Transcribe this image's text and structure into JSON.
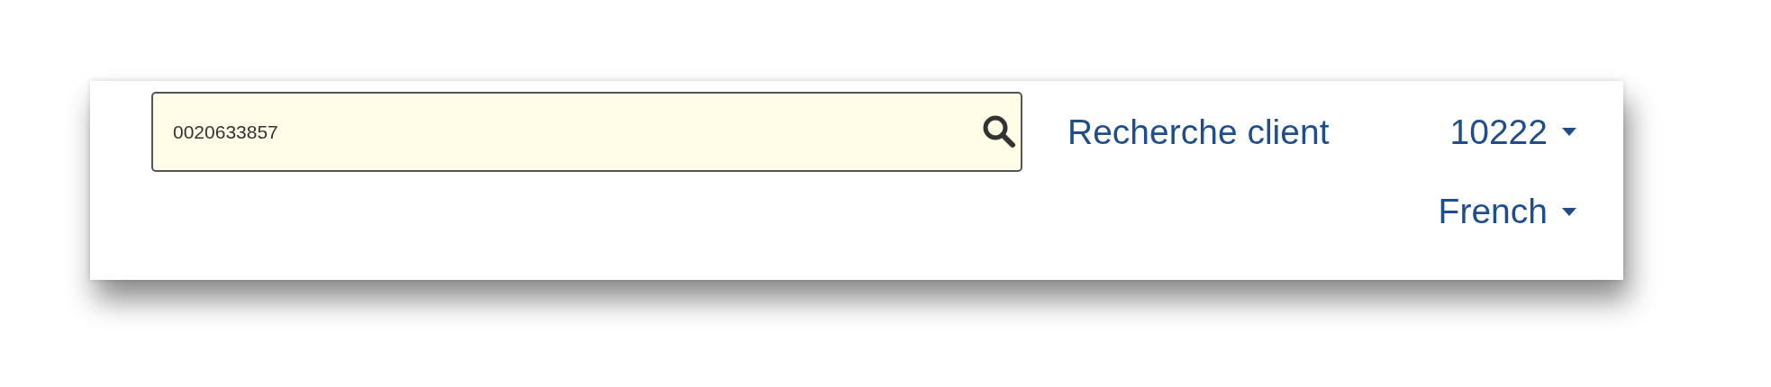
{
  "search": {
    "value": "0020633857"
  },
  "customer_search_link": {
    "label": "Recherche client"
  },
  "user_menu": {
    "label": "10222"
  },
  "language_menu": {
    "label": "French"
  }
}
